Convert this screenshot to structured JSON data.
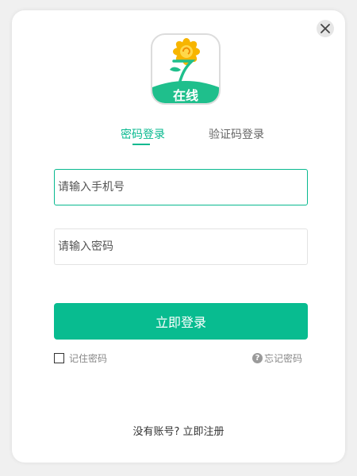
{
  "tabs": {
    "password_login": "密码登录",
    "code_login": "验证码登录"
  },
  "logo": {
    "text": "在线"
  },
  "form": {
    "phone_placeholder": "请输入手机号",
    "password_placeholder": "请输入密码",
    "phone_value": "",
    "password_value": ""
  },
  "actions": {
    "login_label": "立即登录",
    "remember_label": "记住密码",
    "forgot_label": "忘记密码",
    "register_prompt": "没有账号?",
    "register_link": "立即注册"
  },
  "colors": {
    "accent": "#08bc90"
  }
}
